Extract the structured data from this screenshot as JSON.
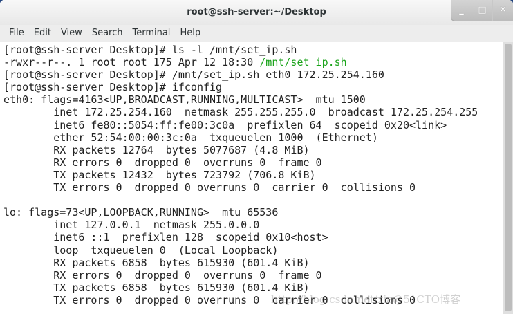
{
  "window": {
    "title": "root@ssh-server:~/Desktop",
    "minimize": "_",
    "maximize": "□",
    "close": "✕"
  },
  "menu": [
    "File",
    "Edit",
    "View",
    "Search",
    "Terminal",
    "Help"
  ],
  "terminal": {
    "lines": [
      "[root@ssh-server Desktop]# ls -l /mnt/set_ip.sh",
      "-rwxr--r--. 1 root root 175 Apr 12 18:30 ",
      "[root@ssh-server Desktop]# /mnt/set_ip.sh eth0 172.25.254.160",
      "[root@ssh-server Desktop]# ifconfig",
      "eth0: flags=4163<UP,BROADCAST,RUNNING,MULTICAST>  mtu 1500",
      "        inet 172.25.254.160  netmask 255.255.255.0  broadcast 172.25.254.255",
      "        inet6 fe80::5054:ff:fe00:3c0a  prefixlen 64  scopeid 0x20<link>",
      "        ether 52:54:00:00:3c:0a  txqueuelen 1000  (Ethernet)",
      "        RX packets 12764  bytes 5077687 (4.8 MiB)",
      "        RX errors 0  dropped 0  overruns 0  frame 0",
      "        TX packets 12432  bytes 723792 (706.8 KiB)",
      "        TX errors 0  dropped 0 overruns 0  carrier 0  collisions 0",
      "",
      "lo: flags=73<UP,LOOPBACK,RUNNING>  mtu 65536",
      "        inet 127.0.0.1  netmask 255.0.0.0",
      "        inet6 ::1  prefixlen 128  scopeid 0x10<host>",
      "        loop  txqueuelen 0  (Local Loopback)",
      "        RX packets 6858  bytes 615930 (601.4 KiB)",
      "        RX errors 0  dropped 0  overruns 0  frame 0",
      "        TX packets 6858  bytes 615930 (601.4 KiB)",
      "        TX errors 0  dropped 0 overruns 0  carrier 0  collisions 0"
    ],
    "highlight_path": "/mnt/set_ip.sh",
    "highlight_color": "#1aa31a"
  },
  "watermark": "http://blog.csdn.net/xia@51CTO博客"
}
